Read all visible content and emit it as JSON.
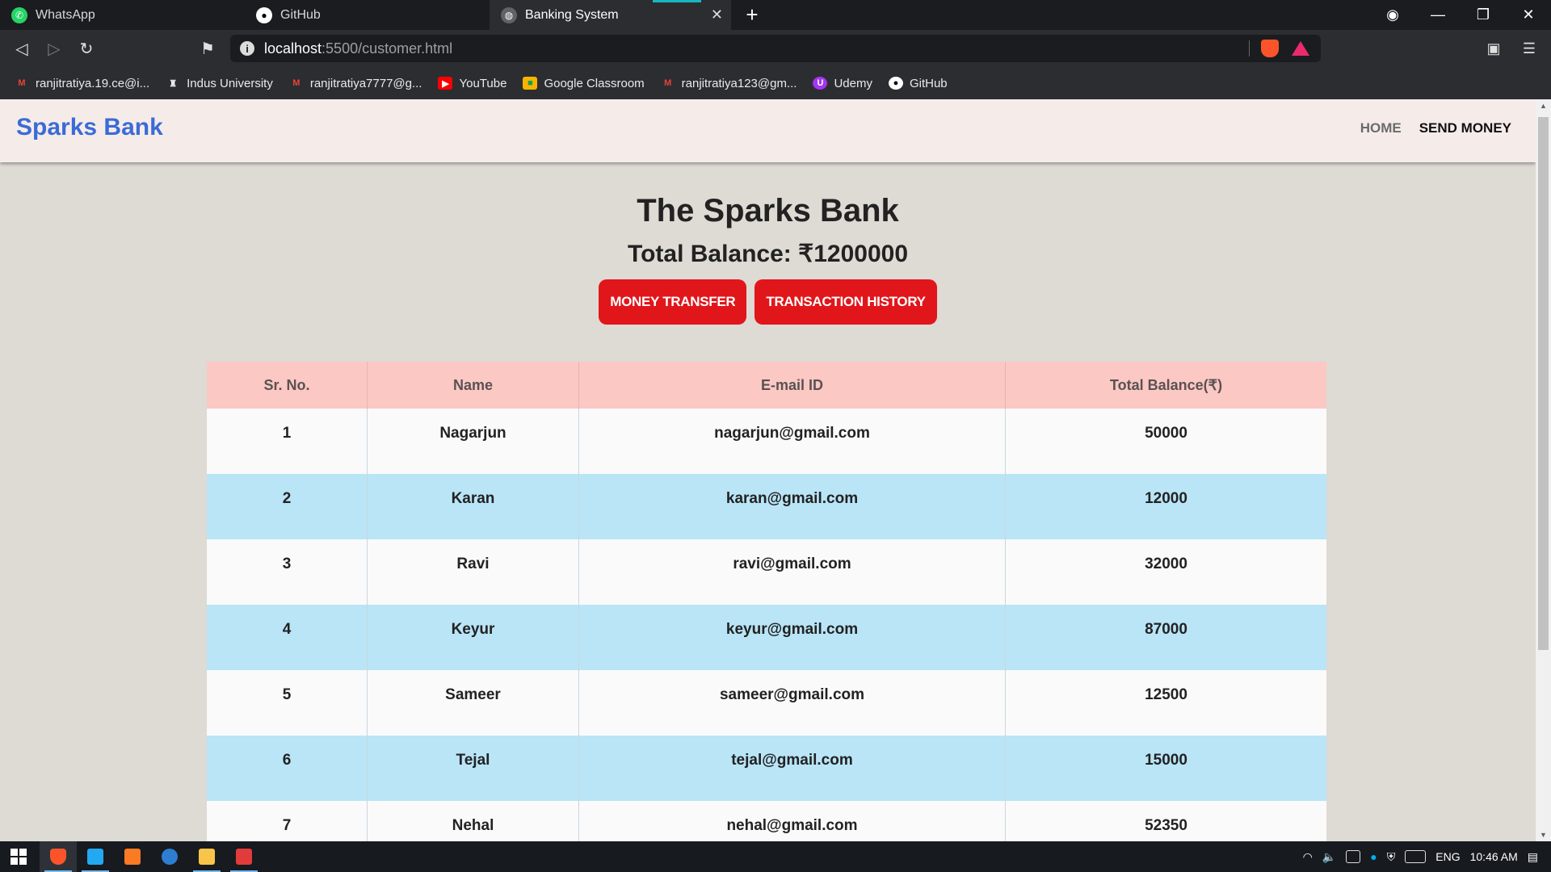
{
  "browser": {
    "tabs": [
      {
        "label": "WhatsApp",
        "icon": "whatsapp-icon"
      },
      {
        "label": "GitHub",
        "icon": "github-icon"
      },
      {
        "label": "Banking System",
        "icon": "globe-icon",
        "active": true
      }
    ],
    "url_host": "localhost",
    "url_path": ":5500/customer.html",
    "bookmarks": [
      {
        "label": "ranjitratiya.19.ce@i...",
        "icon": "gmail-icon",
        "color": "#ea4335"
      },
      {
        "label": "Indus University",
        "icon": "indus-icon",
        "color": "#111111"
      },
      {
        "label": "ranjitratiya7777@g...",
        "icon": "gmail-icon",
        "color": "#ea4335"
      },
      {
        "label": "YouTube",
        "icon": "youtube-icon",
        "color": "#ff0000"
      },
      {
        "label": "Google Classroom",
        "icon": "classroom-icon",
        "color": "#f4b400"
      },
      {
        "label": "ranjitratiya123@gm...",
        "icon": "gmail-icon",
        "color": "#ea4335"
      },
      {
        "label": "Udemy",
        "icon": "udemy-icon",
        "color": "#a435f0"
      },
      {
        "label": "GitHub",
        "icon": "github-icon",
        "color": "#ffffff"
      }
    ]
  },
  "site": {
    "brand": "Sparks Bank",
    "nav": {
      "home": "HOME",
      "send": "SEND MONEY"
    },
    "title": "The Sparks Bank",
    "total_balance": "Total Balance: ₹1200000",
    "buttons": {
      "transfer": "MONEY TRANSFER",
      "history": "TRANSACTION HISTORY"
    },
    "accent_color": "#e1161b",
    "brand_color": "#3b6bd6"
  },
  "table": {
    "headers": [
      "Sr. No.",
      "Name",
      "E-mail ID",
      "Total Balance(₹)"
    ],
    "rows": [
      [
        "1",
        "Nagarjun",
        "nagarjun@gmail.com",
        "50000"
      ],
      [
        "2",
        "Karan",
        "karan@gmail.com",
        "12000"
      ],
      [
        "3",
        "Ravi",
        "ravi@gmail.com",
        "32000"
      ],
      [
        "4",
        "Keyur",
        "keyur@gmail.com",
        "87000"
      ],
      [
        "5",
        "Sameer",
        "sameer@gmail.com",
        "12500"
      ],
      [
        "6",
        "Tejal",
        "tejal@gmail.com",
        "15000"
      ],
      [
        "7",
        "Nehal",
        "nehal@gmail.com",
        "52350"
      ]
    ]
  },
  "taskbar": {
    "language": "ENG",
    "time": "10:46 AM"
  }
}
